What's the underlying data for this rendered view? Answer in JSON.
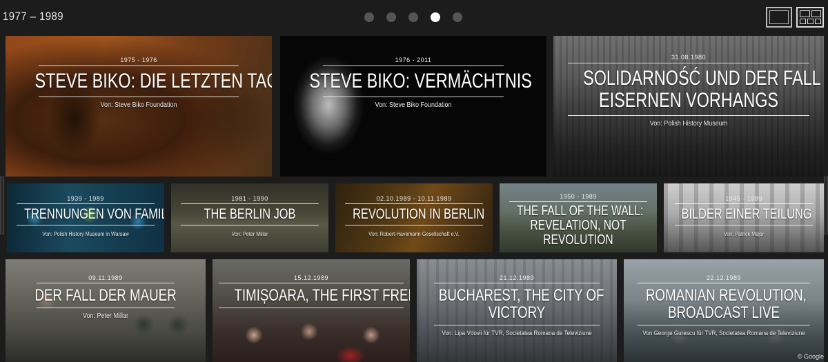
{
  "header": {
    "period": "1977 – 1989",
    "pages": 5,
    "active_page": 4
  },
  "tiles": [
    {
      "date": "1975 - 1976",
      "title_lines": [
        "STEVE BIKO: DIE LETZTEN TAGE"
      ],
      "by": "Von: Steve Biko Foundation"
    },
    {
      "date": "1976 - 2011",
      "title_lines": [
        "STEVE BIKO: VERMÄCHTNIS"
      ],
      "by": "Von: Steve Biko Foundation"
    },
    {
      "date": "31.08.1980",
      "title_lines": [
        "SOLIDARNOŚĆ UND DER FALL DES",
        "EISERNEN VORHANGS"
      ],
      "by": "Von: Polish History Museum"
    },
    {
      "date": "1939 - 1989",
      "title_lines": [
        "TRENNUNGEN VON FAMILIEN"
      ],
      "by": "Von: Polish History Museum in Warsaw"
    },
    {
      "date": "1981 - 1990",
      "title_lines": [
        "THE BERLIN JOB"
      ],
      "by": "Von: Peter Millar"
    },
    {
      "date": "02.10.1989 - 10.11.1989",
      "title_lines": [
        "REVOLUTION IN BERLIN"
      ],
      "by": "Von: Robert-Havemann-Gesellschaft e.V."
    },
    {
      "date": "1950 - 1989",
      "title_lines": [
        "THE FALL OF THE WALL:",
        "REVELATION, NOT",
        "REVOLUTION"
      ],
      "by": ""
    },
    {
      "date": "1945 - 1989",
      "title_lines": [
        "BILDER EINER TEILUNG"
      ],
      "by": "Von: Patrick Major"
    },
    {
      "date": "09.11.1989",
      "title_lines": [
        "DER FALL DER MAUER"
      ],
      "by": "Von: Peter Millar"
    },
    {
      "date": "15.12.1989",
      "title_lines": [
        "TIMIȘOARA, THE FIRST FREE CITY"
      ],
      "by": ""
    },
    {
      "date": "21.12.1989",
      "title_lines": [
        "BUCHAREST, THE CITY OF",
        "VICTORY"
      ],
      "by": "Von: Lipa Vdovii für TVR, Societatea Romana de Televiziune"
    },
    {
      "date": "22.12.1989",
      "title_lines": [
        "ROMANIAN REVOLUTION,",
        "BROADCAST LIVE"
      ],
      "by": "Von George Gurescu für TVR, Societatea Romana de Televiziune"
    }
  ],
  "credit": "© Google",
  "colors": {
    "background": "#1c1c1c",
    "dot_inactive": "#555555",
    "dot_active": "#ffffff"
  },
  "icons": {
    "single_view": "single-view-icon",
    "grid_view": "grid-view-icon"
  }
}
